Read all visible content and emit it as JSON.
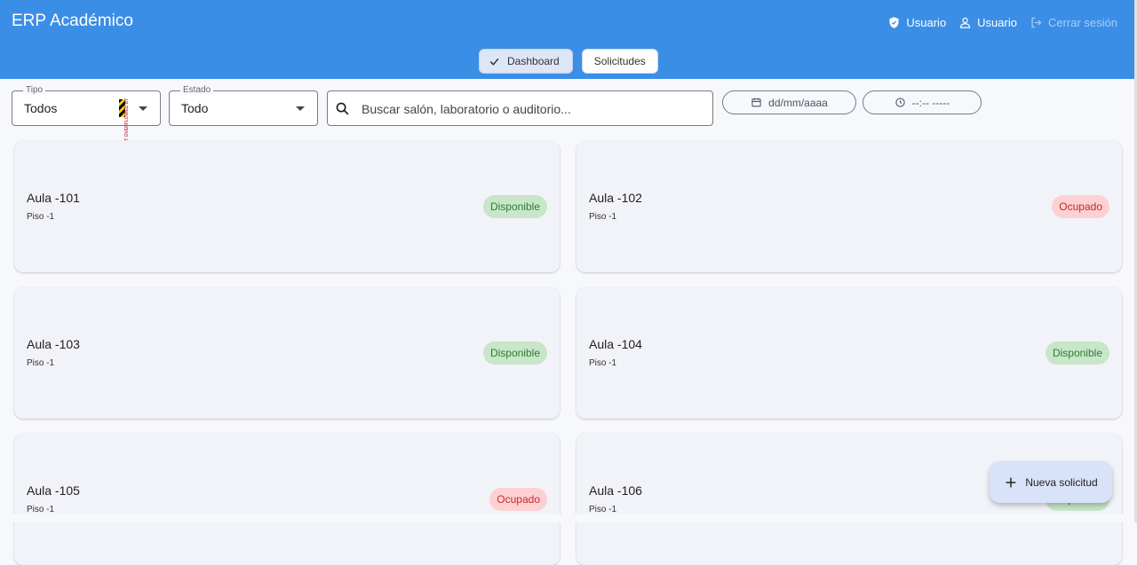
{
  "header": {
    "title": "ERP Académico",
    "role_label": "Usuario",
    "user_label": "Usuario",
    "logout_label": "Cerrar sesión"
  },
  "nav": {
    "tabs": [
      {
        "label": "Dashboard",
        "selected": true
      },
      {
        "label": "Solicitudes",
        "selected": false
      }
    ]
  },
  "filters": {
    "tipo": {
      "label": "Tipo",
      "value": "Todos"
    },
    "estado": {
      "label": "Estado",
      "value": "Todo"
    },
    "search": {
      "placeholder": "Buscar salón, laboratorio o auditorio..."
    },
    "date": {
      "placeholder": "dd/mm/aaaa"
    },
    "time": {
      "placeholder": "--:-- -----"
    },
    "overflow_debug_text": "IT OVERFLOWED BY"
  },
  "rooms": [
    {
      "name": "Aula -101",
      "floor": "Piso -1",
      "status": "Disponible"
    },
    {
      "name": "Aula -102",
      "floor": "Piso -1",
      "status": "Ocupado"
    },
    {
      "name": "Aula -103",
      "floor": "Piso -1",
      "status": "Disponible"
    },
    {
      "name": "Aula -104",
      "floor": "Piso -1",
      "status": "Disponible"
    },
    {
      "name": "Aula -105",
      "floor": "Piso -1",
      "status": "Ocupado"
    },
    {
      "name": "Aula -106",
      "floor": "Piso -1",
      "status": "Disponible"
    }
  ],
  "fab": {
    "label": "Nueva solicitud"
  },
  "colors": {
    "appbar": "#3b8ee6",
    "available_bg": "#c8e6c9",
    "available_fg": "#2e7d32",
    "busy_bg": "#fdd0d3",
    "busy_fg": "#c62828"
  },
  "icons": {
    "role": "shield-check-icon",
    "user": "person-icon",
    "logout": "logout-icon",
    "search": "search-icon",
    "date": "calendar-icon",
    "time": "clock-icon",
    "fab": "plus-icon",
    "selected_tab": "check-icon"
  }
}
